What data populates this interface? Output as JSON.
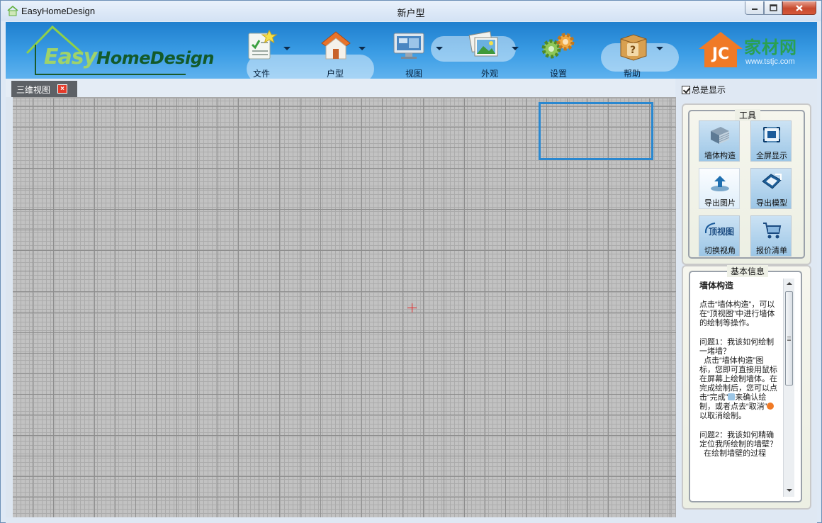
{
  "window": {
    "app_title": "EasyHomeDesign",
    "document_title": "新户型"
  },
  "logo": {
    "part1": "Easy",
    "part2": "HomeDesign"
  },
  "toolbar": {
    "items": [
      {
        "label": "文件",
        "icon": "document-check-icon"
      },
      {
        "label": "户型",
        "icon": "house-icon"
      },
      {
        "label": "视图",
        "icon": "monitor-icon"
      },
      {
        "label": "外观",
        "icon": "pictures-icon"
      },
      {
        "label": "设置",
        "icon": "gears-icon"
      },
      {
        "label": "帮助",
        "icon": "help-box-icon"
      }
    ]
  },
  "brand": {
    "name": "家材网",
    "url": "www.tstjc.com",
    "mark": "JC"
  },
  "tabs": [
    {
      "label": "三维视图"
    }
  ],
  "panel": {
    "always_show_label": "总是显示",
    "always_show_checked": true,
    "tools_title": "工具",
    "tools": [
      {
        "label": "墙体构造",
        "icon": "wall-icon"
      },
      {
        "label": "全屏显示",
        "icon": "fullscreen-icon"
      },
      {
        "label": "导出图片",
        "icon": "export-image-icon"
      },
      {
        "label": "导出模型",
        "icon": "export-model-icon"
      },
      {
        "label": "切换视角",
        "icon": "switch-view-icon",
        "badge": "顶视图"
      },
      {
        "label": "报价清单",
        "icon": "cart-icon"
      }
    ],
    "info_title": "基本信息",
    "info": {
      "heading": "墙体构造",
      "p1": "点击“墙体构造”，可以在“顶视图”中进行墙体的绘制等操作。",
      "p2": "问题1：我该如何绘制一堵墙？\n  点击“墙体构造”图标，您即可直接用鼠标在屏幕上绘制墙体。在完成绘制后，您可以点击“完成”",
      "p2b": "来确认绘制，或者点去“取消”",
      "p2c": "以取消绘制。",
      "p3": "问题2：我该如何精确定位我所绘制的墙壁？\n  在绘制墙壁的过程"
    }
  },
  "colors": {
    "toolbar_top": "#1f7fce",
    "toolbar_bottom": "#5fb2ee",
    "canvas_bg": "#c2c2c2",
    "mini_view_border": "#2a88d0",
    "crosshair": "#e02020",
    "tab_bg": "#5d6166"
  }
}
